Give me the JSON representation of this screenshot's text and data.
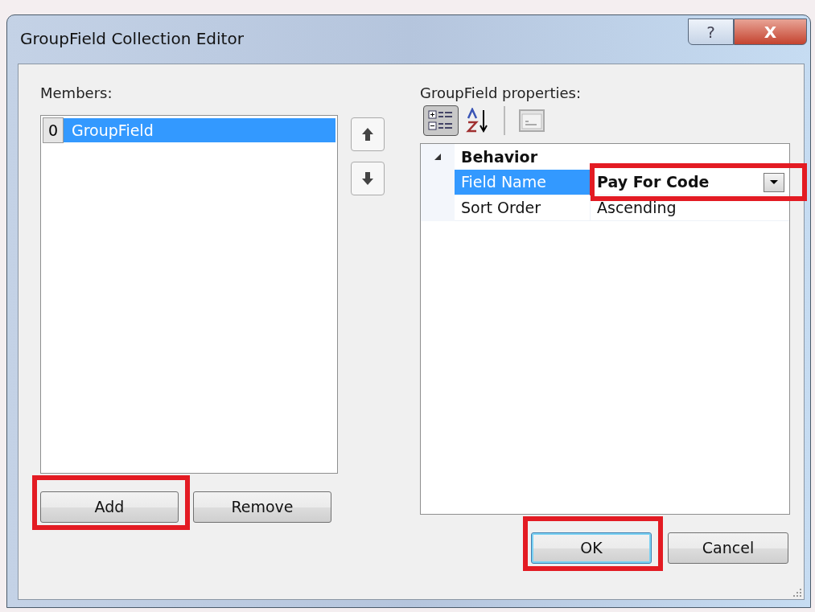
{
  "window": {
    "title": "GroupField Collection Editor",
    "help_button": "?",
    "close_button": "X"
  },
  "members": {
    "label": "Members:",
    "items": [
      {
        "index": "0",
        "name": "GroupField",
        "selected": true
      }
    ],
    "buttons": [
      {
        "label": "Add",
        "highlighted": true
      },
      {
        "label": "Remove",
        "highlighted": false
      }
    ]
  },
  "properties": {
    "label": "GroupField properties:",
    "toolbar": [
      {
        "kind": "categorized",
        "selected": true
      },
      {
        "kind": "alphabetical",
        "selected": false
      },
      {
        "kind": "pages",
        "selected": false
      }
    ],
    "categories": [
      {
        "name": "Behavior",
        "expanded": true,
        "rows": [
          {
            "name": "Field Name",
            "value": "Pay For Code",
            "selected": true,
            "modified": true,
            "highlighted": true
          },
          {
            "name": "Sort Order",
            "value": "Ascending",
            "selected": false,
            "modified": false,
            "highlighted": false
          }
        ]
      }
    ]
  },
  "dialog_buttons": [
    {
      "label": "OK",
      "default": true,
      "highlighted": true
    },
    {
      "label": "Cancel",
      "default": false,
      "highlighted": false
    }
  ]
}
